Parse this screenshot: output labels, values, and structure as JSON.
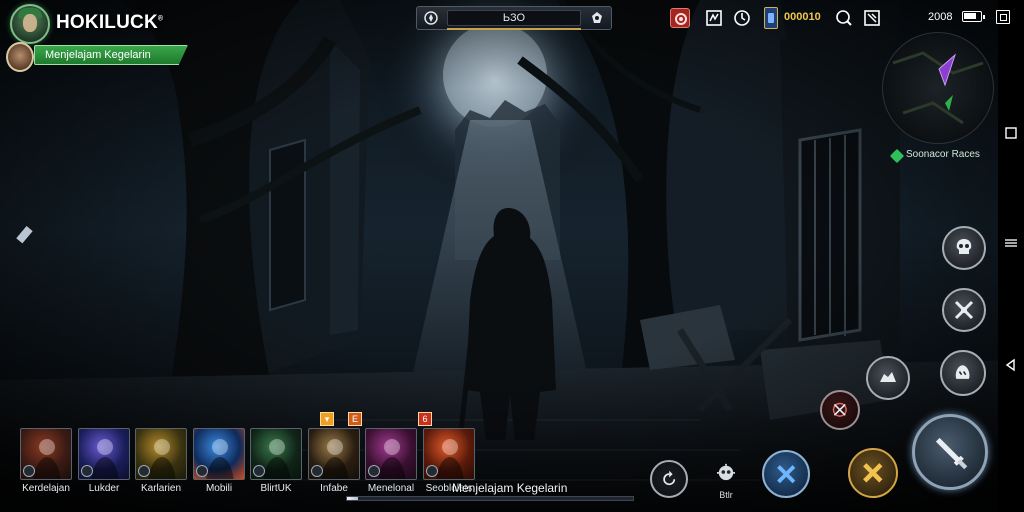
{
  "app": {
    "logo_text": "HOKILUCK",
    "logo_mark": "®",
    "status_banner": "Menjelajam Kegelarin"
  },
  "top_bar": {
    "field_value": "ЬЗО",
    "left_icon": "compass-icon",
    "right_icon": "settings-icon"
  },
  "top_right": {
    "icons": [
      "event-icon",
      "mail-icon",
      "timer-icon",
      "currency-icon",
      "search-icon",
      "bag-icon"
    ],
    "currency_value": "000010",
    "clock": "2008",
    "battery_level": 0.8
  },
  "minimap": {
    "quest_label": "Soonacor Races"
  },
  "heroes": [
    {
      "name": "Kerdelajan",
      "colors": [
        "#3b1a14",
        "#8a3a22",
        "#1a0d0a"
      ]
    },
    {
      "name": "Lukder",
      "colors": [
        "#1a1e5a",
        "#6a5ad0",
        "#0d0f2a"
      ]
    },
    {
      "name": "Karlarien",
      "colors": [
        "#3a3310",
        "#b38a2a",
        "#1c1a08"
      ]
    },
    {
      "name": "Mobili",
      "colors": [
        "#0f2a5a",
        "#3a8ae0",
        "#d04a1a"
      ]
    },
    {
      "name": "BlirtUK",
      "colors": [
        "#102418",
        "#3a7a4a",
        "#0a140c"
      ]
    },
    {
      "name": "Infabe",
      "colors": [
        "#2a1e10",
        "#9a7a4a",
        "#140e08"
      ]
    },
    {
      "name": "Menelonal",
      "colors": [
        "#3a1030",
        "#a03a90",
        "#1a0818"
      ]
    },
    {
      "name": "Seoblolets",
      "colors": [
        "#5a1a0a",
        "#e05a2a",
        "#2a0c05"
      ]
    }
  ],
  "hero_badges": [
    "▾",
    "E",
    "6"
  ],
  "skills": {
    "skill_1": "skull-icon",
    "skill_2": "crossed-blades-icon",
    "skill_3": "beast-claw-icon",
    "skill_4": "wolf-icon",
    "skill_5": "target-icon",
    "skill_6": "crossed-swords-icon",
    "skill_7": "golden-cross-icon",
    "skill_8": "gear-skull-icon",
    "skill_8_label": "Btlr",
    "skill_9": "refresh-icon",
    "attack": "sword-icon"
  },
  "caption": "Menjelajam Kegelarin",
  "caption_progress": 0.04,
  "colors": {
    "banner_green": "#2e9a3f",
    "currency_gold": "#f0c54f",
    "accent_blue": "#3a8ae0"
  }
}
